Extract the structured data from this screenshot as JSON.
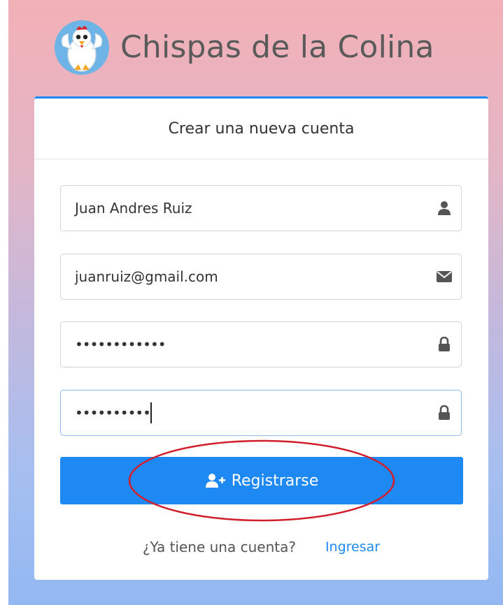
{
  "brand": {
    "title": "Chispas de la Colina"
  },
  "card": {
    "header": "Crear una nueva cuenta"
  },
  "form": {
    "name": {
      "value": "Juan Andres  Ruiz",
      "icon": "user-icon"
    },
    "email": {
      "value": "juanruiz@gmail.com",
      "icon": "envelope-icon"
    },
    "password": {
      "value": "••••••••••••",
      "icon": "lock-icon"
    },
    "confirm_password": {
      "value": "••••••••••",
      "icon": "lock-icon"
    }
  },
  "register_button": {
    "label": "Registrarse",
    "icon": "user-plus-icon"
  },
  "footer": {
    "question": "¿Ya tiene una cuenta?",
    "link": "Ingresar"
  },
  "colors": {
    "accent": "#1e88f3",
    "annotation": "#d11f2c",
    "title": "#5a5a5a"
  }
}
